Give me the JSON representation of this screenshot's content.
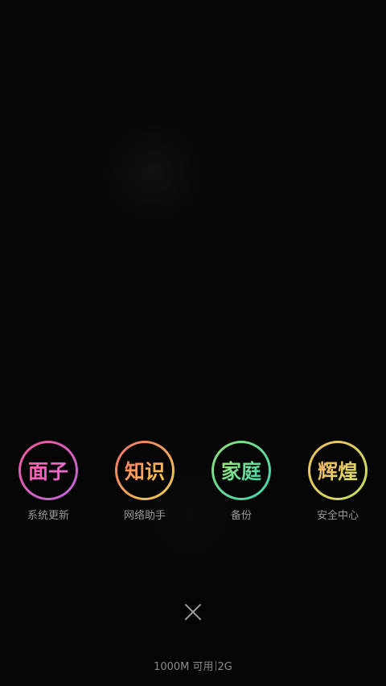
{
  "apps": [
    {
      "glyph": "面子",
      "label": "系统更新",
      "ring_colors": [
        "#f05a9a",
        "#c064e0"
      ],
      "glyph_colors": [
        "#ff5aa0",
        "#e070d8"
      ]
    },
    {
      "glyph": "知识",
      "label": "网络助手",
      "ring_colors": [
        "#f0706a",
        "#f0d050"
      ],
      "glyph_colors": [
        "#ff7a6a",
        "#f4d24a"
      ]
    },
    {
      "glyph": "家庭",
      "label": "备份",
      "ring_colors": [
        "#8ee07a",
        "#40d4b0"
      ],
      "glyph_colors": [
        "#a8e870",
        "#38d6b4"
      ]
    },
    {
      "glyph": "辉煌",
      "label": "安全中心",
      "ring_colors": [
        "#f0c060",
        "#c8e060"
      ],
      "glyph_colors": [
        "#f4b060",
        "#d8e26a"
      ]
    }
  ],
  "close": {
    "icon": "close-icon"
  },
  "status": {
    "memory": "1000M 可用",
    "total": "2G"
  },
  "colors": {
    "background": "#050505",
    "label": "#9a9a9a",
    "close_icon": "#9a9a9a"
  }
}
